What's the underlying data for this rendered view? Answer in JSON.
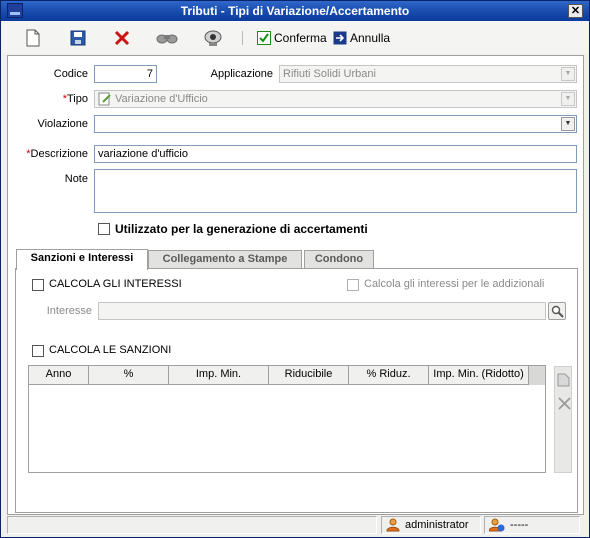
{
  "window": {
    "title": "Tributi - Tipi di Variazione/Accertamento",
    "close_glyph": "✕"
  },
  "toolbar": {
    "conferma_label": "Conferma",
    "annulla_label": "Annulla"
  },
  "form": {
    "codice_label": "Codice",
    "codice_value": "7",
    "applicazione_label": "Applicazione",
    "applicazione_value": "Rifiuti Solidi Urbani",
    "tipo_label": "Tipo",
    "tipo_value": "Variazione d'Ufficio",
    "violazione_label": "Violazione",
    "violazione_value": "",
    "descrizione_label": "Descrizione",
    "descrizione_value": "variazione d'ufficio",
    "note_label": "Note",
    "note_value": "",
    "required_mark": "*",
    "accertamenti_checkbox_label": "Utilizzato per la generazione di accertamenti",
    "accertamenti_checked": false
  },
  "tabs": [
    {
      "label": "Sanzioni e Interessi",
      "active": true
    },
    {
      "label": "Collegamento a Stampe",
      "active": false
    },
    {
      "label": "Condono",
      "active": false
    }
  ],
  "sanzioni": {
    "calcola_interessi_label": "CALCOLA GLI INTERESSI",
    "calcola_addizionali_label": "Calcola gli interessi per le addizionali",
    "interesse_label": "Interesse",
    "interesse_value": "",
    "calcola_sanzioni_label": "CALCOLA LE SANZIONI"
  },
  "grid": {
    "columns": [
      "Anno",
      "%",
      "Imp. Min.",
      "Riducibile",
      "% Riduz.",
      "Imp. Min. (Ridotto)"
    ],
    "rows": []
  },
  "status": {
    "user": "administrator",
    "info": "-----"
  },
  "colors": {
    "titlebar": "#0b3b9c",
    "required": "#d40000",
    "delete": "#cc1111",
    "confirm": "#1a8a1a",
    "cancel": "#1b3a8c"
  }
}
